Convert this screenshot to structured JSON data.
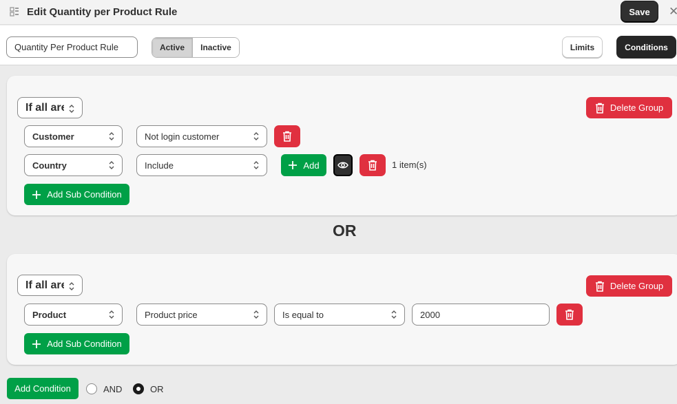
{
  "header": {
    "title": "Edit Quantity per Product Rule",
    "save_label": "Save",
    "close_label": "✕"
  },
  "toolbar": {
    "rule_name_value": "Quantity Per Product Rule",
    "status_active_label": "Active",
    "status_inactive_label": "Inactive",
    "selected_status": "Active",
    "limits_label": "Limits",
    "conditions_label": "Conditions"
  },
  "groups": [
    {
      "match_label": "If all are",
      "delete_group_label": "Delete Group",
      "conditions": [
        {
          "field": "Customer",
          "operator": "Not login customer"
        },
        {
          "field": "Country",
          "operator": "Include",
          "add_label": "Add",
          "items_count": "1 item(s)"
        }
      ],
      "add_sub_condition_label": "Add Sub Condition"
    },
    {
      "match_label": "If all are",
      "delete_group_label": "Delete Group",
      "conditions": [
        {
          "field": "Product",
          "attribute": "Product price",
          "comparator": "Is equal to",
          "value": "2000"
        }
      ],
      "add_sub_condition_label": "Add Sub Condition"
    }
  ],
  "or_separator": "OR",
  "footer": {
    "add_condition_label": "Add Condition",
    "and_label": "AND",
    "or_label": "OR",
    "selected_logic": "OR"
  },
  "colors": {
    "primary_dark": "#303030",
    "danger": "#e0303f",
    "success": "#00a047",
    "background": "#ebebeb"
  },
  "icons": [
    "app-icon",
    "close-icon",
    "chevron-updown-icon",
    "trash-icon",
    "plus-icon",
    "eye-icon"
  ]
}
